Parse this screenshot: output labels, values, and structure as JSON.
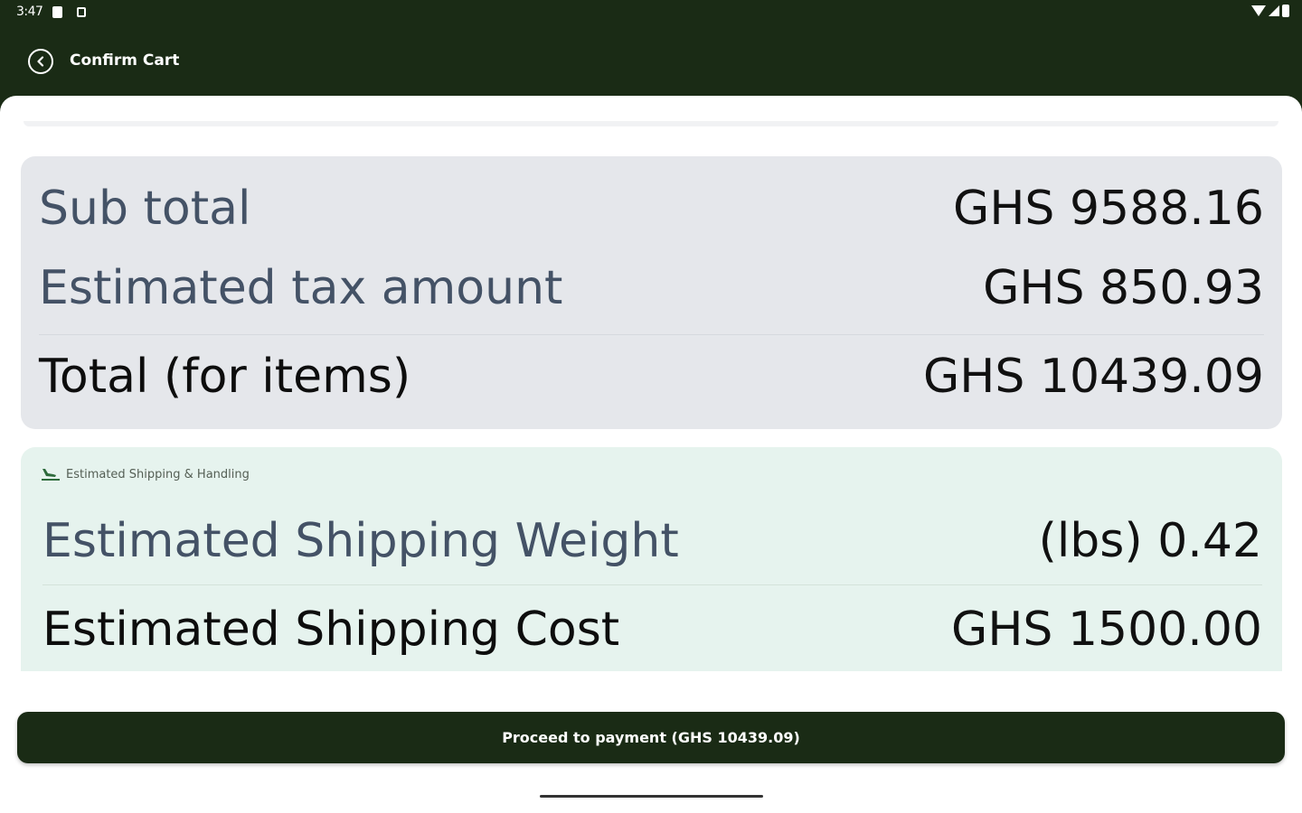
{
  "status_bar": {
    "time": "3:47",
    "icons": [
      "note-icon",
      "box-icon",
      "wifi-icon",
      "signal-icon",
      "battery-icon"
    ]
  },
  "app_bar": {
    "title": "Confirm Cart",
    "back_icon": "chevron-left-circle-icon"
  },
  "summary": {
    "subtotal_label": "Sub total",
    "subtotal_value": "GHS 9588.16",
    "tax_label": "Estimated tax amount",
    "tax_value": "GHS 850.93",
    "total_label": "Total (for items)",
    "total_value": "GHS 10439.09"
  },
  "shipping": {
    "header_icon": "airplane-landing-icon",
    "header": "Estimated Shipping & Handling",
    "weight_label": "Estimated Shipping Weight",
    "weight_value": "(lbs) 0.42",
    "cost_label": "Estimated Shipping Cost",
    "cost_value": "GHS 1500.00"
  },
  "proceed_button_label": "Proceed to payment (GHS 10439.09)",
  "colors": {
    "primary": "#1a2b15",
    "summary_bg": "#e5e7eb",
    "shipping_bg": "#e6f3ee",
    "label_text": "#445266"
  }
}
